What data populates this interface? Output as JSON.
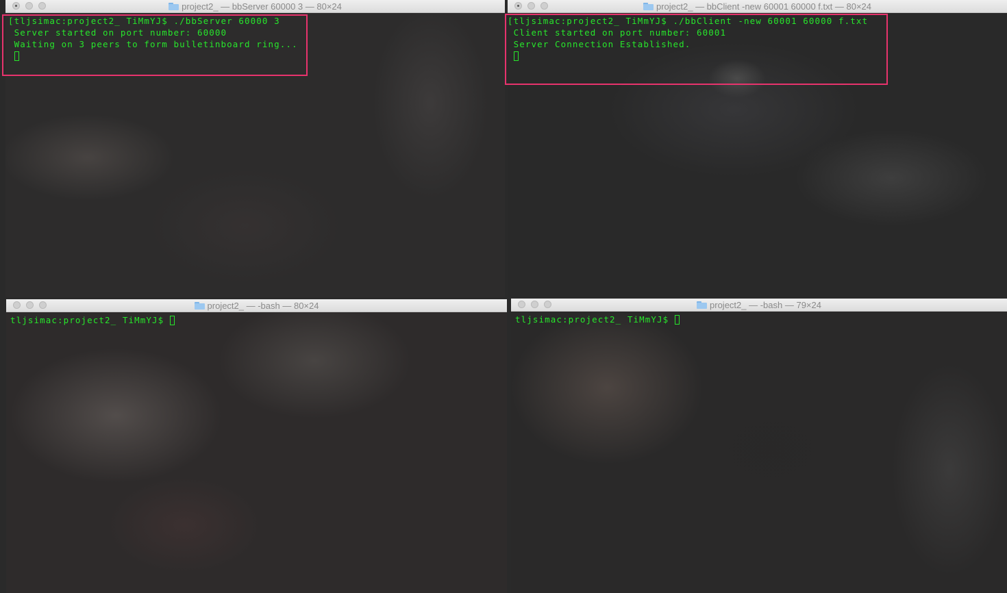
{
  "windows": [
    {
      "title": "project2_ — bbServer 60000 3 — 80×24",
      "lines": [
        "[tljsimac:project2_ TiMmYJ$ ./bbServer 60000 3",
        " Server started on port number: 60000",
        " Waiting on 3 peers to form bulletinboard ring..."
      ]
    },
    {
      "title": "project2_ — bbClient -new 60001 60000 f.txt — 80×24",
      "lines": [
        "[tljsimac:project2_ TiMmYJ$ ./bbClient -new 60001 60000 f.txt",
        " Client started on port number: 60001",
        " Server Connection Established."
      ]
    },
    {
      "title": "project2_ — -bash — 80×24",
      "prompt": "tljsimac:project2_ TiMmYJ$ "
    },
    {
      "title": "project2_ — -bash — 79×24",
      "prompt": "tljsimac:project2_ TiMmYJ$ "
    }
  ],
  "colors": {
    "terminal_text": "#27e62b",
    "highlight_border": "#e8336d",
    "titlebar": "#e4e4e4"
  },
  "icons": {
    "title_icon": "folder-icon",
    "cursor": "block-cursor"
  }
}
